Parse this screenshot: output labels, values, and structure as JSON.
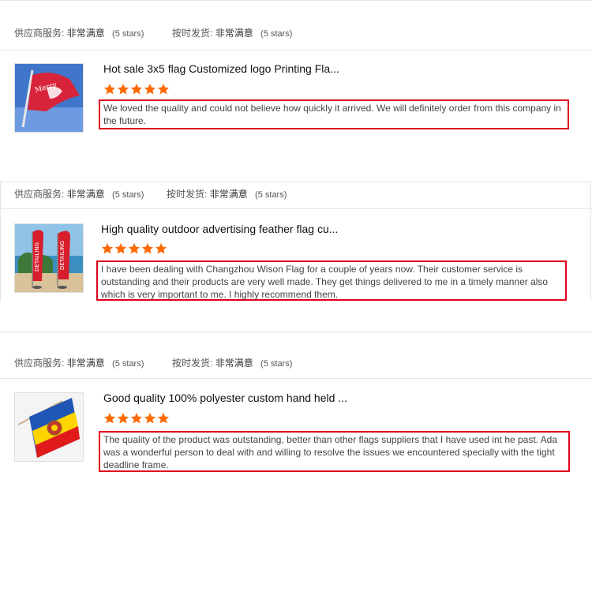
{
  "colors": {
    "star": "#ff6a00",
    "highlight": "#e0001b"
  },
  "reviews": [
    {
      "supplier_service_label": "供应商服务:",
      "supplier_service_value": "非常满意",
      "supplier_service_stars": "(5 stars)",
      "on_time_label": "按时发货:",
      "on_time_value": "非常满意",
      "on_time_stars": "(5 stars)",
      "product_title": "Hot sale 3x5 flag Customized logo Printing Fla...",
      "rating": 5,
      "review_text": "We loved the quality and could not believe how quickly it arrived. We will definitely order from this company in the future.",
      "thumbnail_icon": "red-flag-image"
    },
    {
      "supplier_service_label": "供应商服务:",
      "supplier_service_value": "非常满意",
      "supplier_service_stars": "(5 stars)",
      "on_time_label": "按时发货:",
      "on_time_value": "非常满意",
      "on_time_stars": "(5 stars)",
      "product_title": "High quality outdoor advertising feather flag cu...",
      "rating": 5,
      "review_text": "I have been dealing with Changzhou Wison Flag for a couple of years now. Their customer service is outstanding and their products are very well made. They get things delivered to me in a timely manner also which is very important to me. I highly recommend them.",
      "thumbnail_icon": "feather-flag-image",
      "thumbnail_text": "DETAILING"
    },
    {
      "supplier_service_label": "供应商服务:",
      "supplier_service_value": "非常满意",
      "supplier_service_stars": "(5 stars)",
      "on_time_label": "按时发货:",
      "on_time_value": "非常满意",
      "on_time_stars": "(5 stars)",
      "product_title": "Good quality 100% polyester custom hand held ...",
      "rating": 5,
      "review_text": "The quality of the product was outstanding, better than other flags suppliers that I have used int he past. Ada was a wonderful person to deal with and willing to resolve the issues we encountered specially with the tight deadline frame.",
      "thumbnail_icon": "hand-held-flag-image"
    }
  ]
}
